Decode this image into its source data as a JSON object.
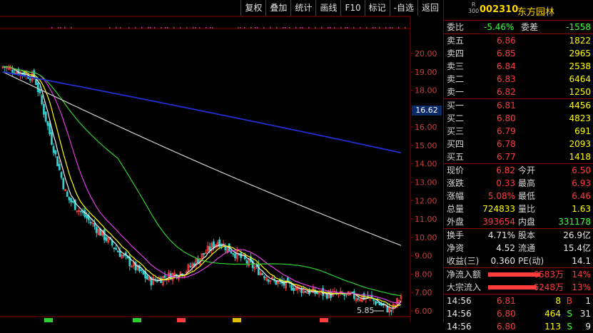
{
  "toolbar": [
    "复权",
    "叠加",
    "统计",
    "画线",
    "F10",
    "标记",
    "-自选",
    "返回"
  ],
  "chart": {
    "y_ticks": [
      "20.00",
      "19.00",
      "18.00",
      "17.00",
      "16.00",
      "15.00",
      "14.00",
      "13.00",
      "12.00",
      "11.00",
      "10.00",
      "9.00",
      "8.00",
      "7.00",
      "6.00"
    ],
    "current_price_label": "16.62",
    "low_label": "5.85",
    "bottom_markers": [
      "",
      "",
      "",
      "",
      ""
    ]
  },
  "stock": {
    "r_mark_1": "R",
    "r_mark_2": "300",
    "code": "002310",
    "name": "东方园林"
  },
  "weibi": {
    "label": "委比",
    "value": "-5.46%",
    "label2": "委差",
    "value2": "-1558"
  },
  "asks": [
    {
      "label": "卖五",
      "price": "6.86",
      "vol": "1822"
    },
    {
      "label": "卖四",
      "price": "6.85",
      "vol": "2965"
    },
    {
      "label": "卖三",
      "price": "6.84",
      "vol": "2538"
    },
    {
      "label": "卖二",
      "price": "6.83",
      "vol": "6464"
    },
    {
      "label": "卖一",
      "price": "6.82",
      "vol": "1250"
    }
  ],
  "bids": [
    {
      "label": "买一",
      "price": "6.81",
      "vol": "4456"
    },
    {
      "label": "买二",
      "price": "6.80",
      "vol": "4823"
    },
    {
      "label": "买三",
      "price": "6.79",
      "vol": "691"
    },
    {
      "label": "买四",
      "price": "6.78",
      "vol": "2093"
    },
    {
      "label": "买五",
      "price": "6.77",
      "vol": "1418"
    }
  ],
  "stats": [
    {
      "l1": "现价",
      "v1": "6.82",
      "l2": "今开",
      "v2": "6.50"
    },
    {
      "l1": "涨跌",
      "v1": "0.33",
      "l2": "最高",
      "v2": "6.93"
    },
    {
      "l1": "涨幅",
      "v1": "5.08%",
      "l2": "最低",
      "v2": "6.46"
    },
    {
      "l1": "总量",
      "v1": "724833",
      "l2": "量比",
      "v2": "1.63"
    },
    {
      "l1": "外盘",
      "v1": "393654",
      "l2": "内盘",
      "v2": "331178"
    }
  ],
  "fund": [
    {
      "l1": "换手",
      "v1": "4.71%",
      "l2": "股本",
      "v2": "26.9亿"
    },
    {
      "l1": "净资",
      "v1": "4.52",
      "l2": "流通",
      "v2": "15.4亿"
    },
    {
      "l1": "收益(三)",
      "v1": "0.360",
      "l2": "PE(动)",
      "v2": "14.1"
    }
  ],
  "flows": [
    {
      "label": "净流入额",
      "value": "6583万",
      "pct": "14%",
      "fill_pct": 14
    },
    {
      "label": "大宗流入",
      "value": "6248万",
      "pct": "13%",
      "fill_pct": 13
    }
  ],
  "ticks": [
    {
      "time": "14:56",
      "price": "6.81",
      "vol": "8",
      "side": "B",
      "n": "1"
    },
    {
      "time": "14:56",
      "price": "6.80",
      "vol": "464",
      "side": "S",
      "n": "31"
    },
    {
      "time": "14:56",
      "price": "6.80",
      "vol": "113",
      "side": "S",
      "n": "9"
    }
  ]
}
